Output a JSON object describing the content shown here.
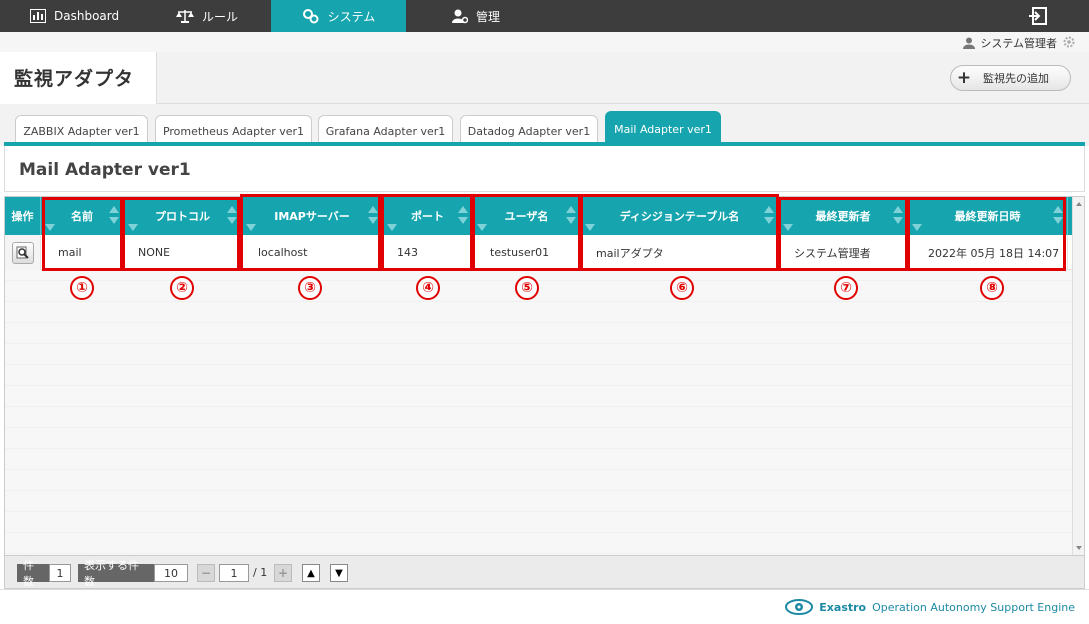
{
  "nav": {
    "items": [
      {
        "label": "Dashboard",
        "icon": "dashboard-icon"
      },
      {
        "label": "ルール",
        "icon": "scales-icon"
      },
      {
        "label": "システム",
        "icon": "gears-icon"
      },
      {
        "label": "管理",
        "icon": "admin-user-icon"
      }
    ],
    "active_index": 2
  },
  "user": {
    "name": "システム管理者"
  },
  "page": {
    "title": "監視アダプタ",
    "add_button": "監視先の追加"
  },
  "tabs": [
    {
      "label": "ZABBIX Adapter ver1"
    },
    {
      "label": "Prometheus Adapter ver1"
    },
    {
      "label": "Grafana Adapter ver1"
    },
    {
      "label": "Datadog Adapter ver1"
    },
    {
      "label": "Mail Adapter ver1"
    }
  ],
  "active_tab": 4,
  "section": {
    "title": "Mail Adapter ver1"
  },
  "table": {
    "op_header": "操作",
    "columns": [
      "名前",
      "プロトコル",
      "IMAPサーバー",
      "ポート",
      "ユーザ名",
      "ディシジョンテーブル名",
      "最終更新者",
      "最終更新日時"
    ],
    "rows": [
      [
        "mail",
        "NONE",
        "localhost",
        "143",
        "testuser01",
        "mailアダプタ",
        "システム管理者",
        "2022年 05月 18日 14:07"
      ]
    ]
  },
  "callouts": [
    "①",
    "②",
    "③",
    "④",
    "⑤",
    "⑥",
    "⑦",
    "⑧"
  ],
  "pager": {
    "count_label": "件数",
    "count": "1",
    "per_page_label": "表示する件数",
    "per_page": "10",
    "page": "1",
    "total": "/ 1"
  },
  "footer": {
    "brand": "Exastro",
    "tagline": "Operation Autonomy Support Engine"
  },
  "colors": {
    "accent": "#16a5ae",
    "nav_bg": "#3d3d3d",
    "annotation": "#e00000"
  }
}
